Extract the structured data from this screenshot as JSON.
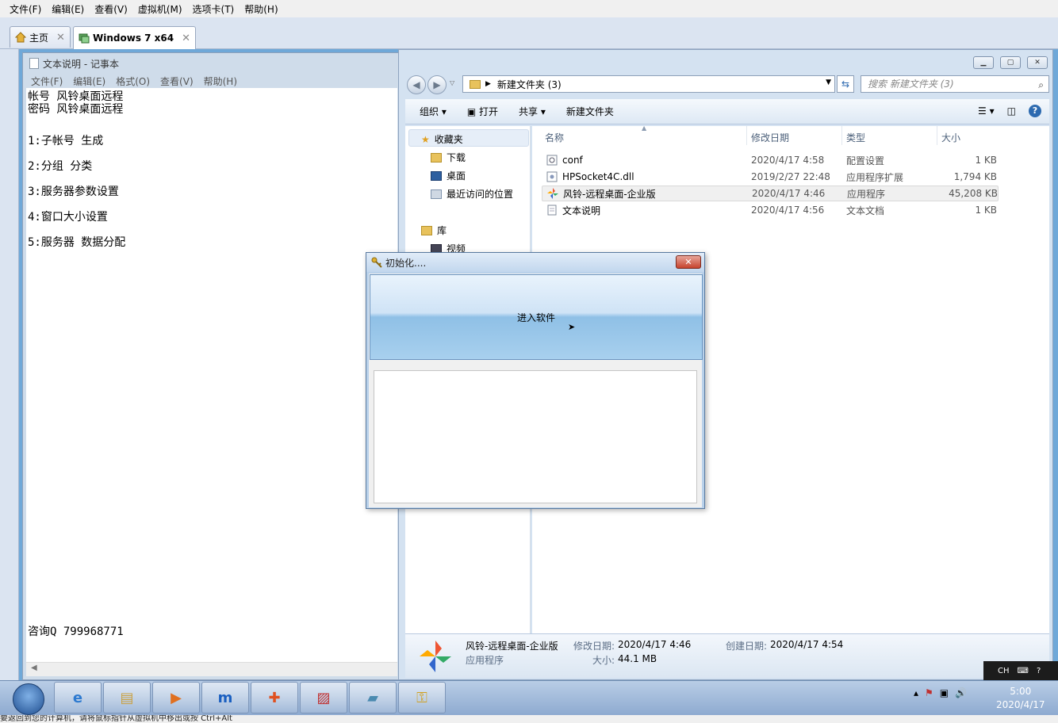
{
  "vm": {
    "menu": [
      "文件(F)",
      "编辑(E)",
      "查看(V)",
      "虚拟机(M)",
      "选项卡(T)",
      "帮助(H)"
    ],
    "tabs": [
      {
        "label": "主页",
        "active": false
      },
      {
        "label": "Windows 7 x64",
        "active": true
      }
    ],
    "status_text": "要返回到您的计算机，请将鼠标指针从虚拟机中移出或按 Ctrl+Alt"
  },
  "notepad": {
    "title": "文本说明 - 记事本",
    "menu": [
      "文件(F)",
      "编辑(E)",
      "格式(O)",
      "查看(V)",
      "帮助(H)"
    ],
    "lines": {
      "account": "帐号 风铃桌面远程",
      "password": "密码 风铃桌面远程",
      "item1": "1:子帐号 生成",
      "item2": "2:分组 分类",
      "item3": "3:服务器参数设置",
      "item4": "4:窗口大小设置",
      "item5": "5:服务器 数据分配",
      "consult": "咨询Q 799968771"
    }
  },
  "explorer": {
    "breadcrumb": "新建文件夹 (3)",
    "search_placeholder": "搜索 新建文件夹 (3)",
    "toolbar": {
      "organize": "组织",
      "open": "打开",
      "share": "共享",
      "new_folder": "新建文件夹"
    },
    "nav": {
      "favorites": "收藏夹",
      "downloads": "下载",
      "desktop": "桌面",
      "recent": "最近访问的位置",
      "libraries": "库",
      "videos": "视频"
    },
    "columns": {
      "name": "名称",
      "date": "修改日期",
      "type": "类型",
      "size": "大小"
    },
    "files": [
      {
        "name": "conf",
        "date": "2020/4/17 4:58",
        "type": "配置设置",
        "size": "1 KB",
        "icon": "settings-file-icon"
      },
      {
        "name": "HPSocket4C.dll",
        "date": "2019/2/27 22:48",
        "type": "应用程序扩展",
        "size": "1,794 KB",
        "icon": "dll-file-icon"
      },
      {
        "name": "风铃-远程桌面-企业版",
        "date": "2020/4/17 4:46",
        "type": "应用程序",
        "size": "45,208 KB",
        "icon": "app-pinwheel-icon",
        "selected": true
      },
      {
        "name": "文本说明",
        "date": "2020/4/17 4:56",
        "type": "文本文档",
        "size": "1 KB",
        "icon": "text-file-icon"
      }
    ],
    "details": {
      "name": "风铃-远程桌面-企业版",
      "kind": "应用程序",
      "modified_label": "修改日期:",
      "modified": "2020/4/17 4:46",
      "created_label": "创建日期:",
      "created": "2020/4/17 4:54",
      "size_label": "大小:",
      "size": "44.1 MB"
    }
  },
  "dialog": {
    "title": "初始化....",
    "button": "进入软件"
  },
  "taskbar": {
    "lang": "CH",
    "time": "5:00",
    "date": "2020/4/17"
  },
  "colors": {
    "accent": "#2d6ab0",
    "taskbar": "#8eaad0",
    "close_red": "#c7432d"
  }
}
